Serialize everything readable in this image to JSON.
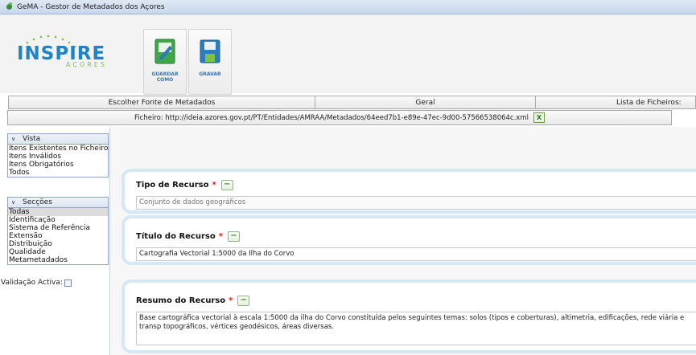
{
  "window": {
    "title": "GeMA - Gestor de Metadados dos Açores"
  },
  "logo": {
    "main_text": "INSPIRE",
    "sub_text": "AÇORES"
  },
  "toolbar": {
    "save_as": {
      "label_line1": "GUARDAR",
      "label_line2": "COMO"
    },
    "save": {
      "label": "GRAVAR"
    }
  },
  "tabs": [
    "Escolher Fonte de Metadados",
    "Geral",
    "Lista de Ficheiros:"
  ],
  "filebar": {
    "text": "Ficheiro: http://ideia.azores.gov.pt/PT/Entidades/AMRAA/Metadados/64eed7b1-e89e-47ec-9d00-57566538064c.xml",
    "close_label": "X"
  },
  "sidebar": {
    "vista": {
      "header": "Vista",
      "items": [
        "Itens Existentes no Ficheiro",
        "Itens Inválidos",
        "Itens Obrigatórios",
        "Todos"
      ]
    },
    "seccoes": {
      "header": "Secções",
      "items": [
        "Todas",
        "Identificação",
        "Sistema de Referência",
        "Extensão",
        "Distribuição",
        "Qualidade",
        "Metametadados"
      ],
      "selected": "Todas"
    },
    "validation_label": "Validação Activa:"
  },
  "panels": [
    {
      "label": "Tipo de Recurso",
      "required": "*",
      "collapse": "−",
      "value": "Conjunto de dados geográficos"
    },
    {
      "label": "Título do Recurso",
      "required": "*",
      "collapse": "−",
      "value": "Cartografia Vectorial 1:5000 da Ilha do Corvo"
    },
    {
      "label": "Resumo do Recurso",
      "required": "*",
      "collapse": "−",
      "value": "Base cartográfica vectorial à escala 1:5000 da ilha do Corvo constituída pelos seguintes temas: solos (tipos e coberturas), altimetria, edificações, rede viária e transp topográficos, vértices geodésicos, áreas diversas."
    }
  ],
  "colors": {
    "accent": "#3a74b8",
    "panel_border": "#d6e8f3",
    "required": "#d02020",
    "brand_green": "#6bbf4e"
  }
}
